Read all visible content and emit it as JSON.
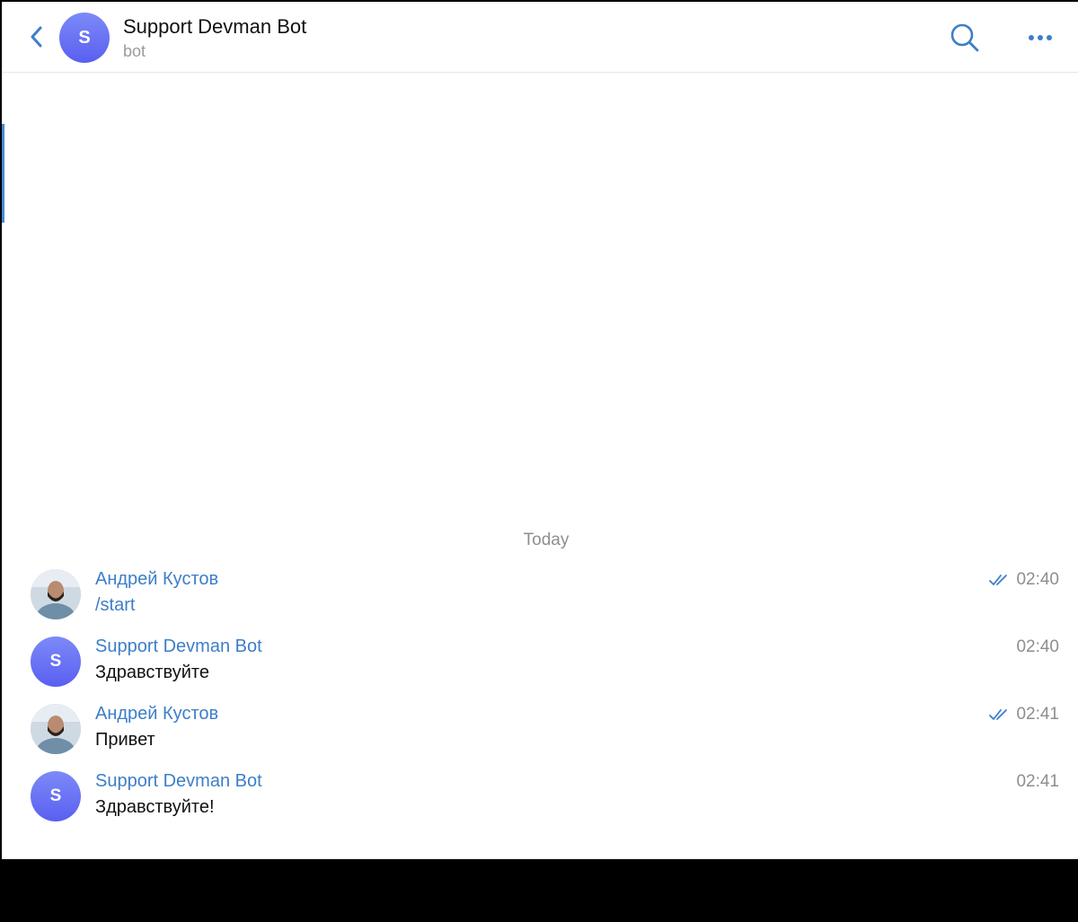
{
  "header": {
    "avatar_letter": "S",
    "title": "Support Devman Bot",
    "subtitle": "bot",
    "back_icon": "chevron-left-icon",
    "search_icon": "search-icon",
    "more_icon": "more-horizontal-icon"
  },
  "date_separator": "Today",
  "messages": [
    {
      "sender": "Андрей Кустов",
      "text": "/start",
      "time": "02:40",
      "read": true,
      "avatar": "user-photo"
    },
    {
      "sender": "Support Devman Bot",
      "text": "Здравствуйте",
      "time": "02:40",
      "read": false,
      "avatar_letter": "S"
    },
    {
      "sender": "Андрей Кустов",
      "text": "Привет",
      "time": "02:41",
      "read": true,
      "avatar": "user-photo"
    },
    {
      "sender": "Support Devman Bot",
      "text": "Здравствуйте!",
      "time": "02:41",
      "read": false,
      "avatar_letter": "S"
    }
  ],
  "colors": {
    "accent": "#3d7ec8",
    "avatar_gradient_top": "#7c8af8",
    "avatar_gradient_bottom": "#5a5ff0",
    "muted": "#8e8e8e"
  }
}
